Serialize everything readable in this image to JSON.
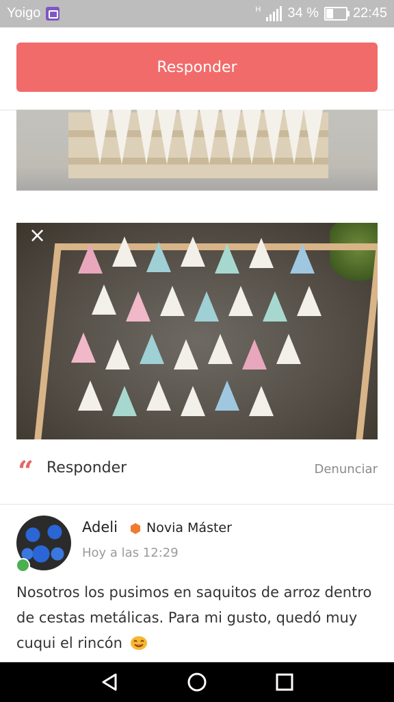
{
  "status_bar": {
    "carrier": "Yoigo",
    "network": "H",
    "battery": "34 %",
    "battery_level": 0.34,
    "time": "22:45",
    "icons": [
      "gallery-notification-icon",
      "signal-icon",
      "battery-icon"
    ]
  },
  "header": {
    "reply_button_label": "Responder"
  },
  "images": [
    {
      "name": "paper-cones-on-wooden-stand-photo"
    },
    {
      "name": "paper-cones-in-wire-basket-photo",
      "close_icon": "×"
    }
  ],
  "actions": {
    "quote_icon": "“",
    "reply_label": "Responder",
    "report_label": "Denunciar"
  },
  "comment": {
    "author": "Adeli",
    "badge": "Novia Máster",
    "badge_color": "#f07a2e",
    "online": true,
    "timestamp": "Hoy a las 12:29",
    "text": "Nosotros los pusimos en saquitos de arroz dentro de cestas metálicas. Para mi gusto, quedó muy cuqui el rincón",
    "emoji": "smiling-face-emoji"
  },
  "colors": {
    "accent": "#f26b6b",
    "status_bar": "#bdbdbd",
    "nav_bar": "#000000"
  },
  "navigation": {
    "buttons": [
      "back-icon",
      "home-icon",
      "recents-icon"
    ]
  }
}
